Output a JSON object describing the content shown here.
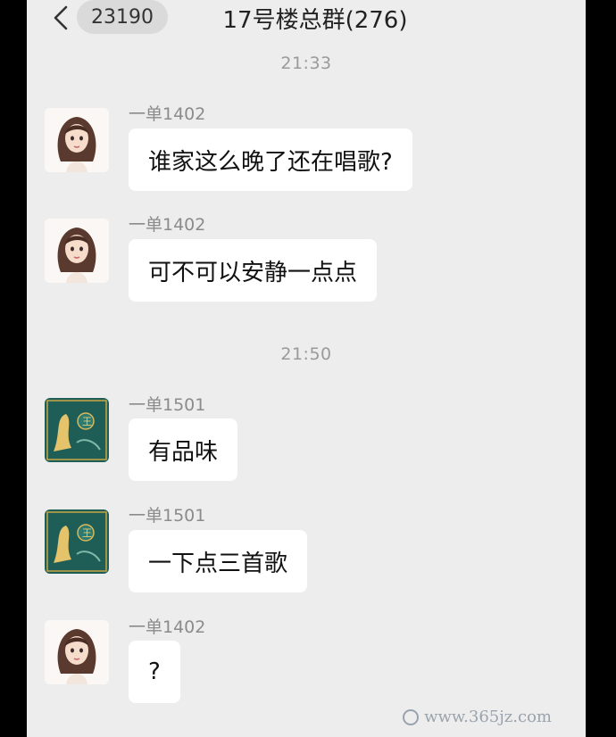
{
  "header": {
    "back_icon": "chevron-left-icon",
    "unread_count": "23190",
    "title": "17号楼总群(276)"
  },
  "timestamps": [
    "21:33",
    "21:50"
  ],
  "messages": [
    {
      "sender": "一单1402",
      "text": "谁家这么晚了还在唱歌?",
      "avatar": "girl-portrait"
    },
    {
      "sender": "一单1402",
      "text": "可不可以安静一点点",
      "avatar": "girl-portrait"
    },
    {
      "sender": "一单1501",
      "text": "有品味",
      "avatar": "jade-artwork"
    },
    {
      "sender": "一单1501",
      "text": "一下点三首歌",
      "avatar": "jade-artwork"
    },
    {
      "sender": "一单1402",
      "text": "?",
      "avatar": "girl-portrait"
    }
  ],
  "watermark": "www.365jz.com",
  "colors": {
    "background": "#EDEDED",
    "bubble": "#FFFFFF",
    "timestamp": "#9A9A9A",
    "sender": "#8B8B8B"
  }
}
